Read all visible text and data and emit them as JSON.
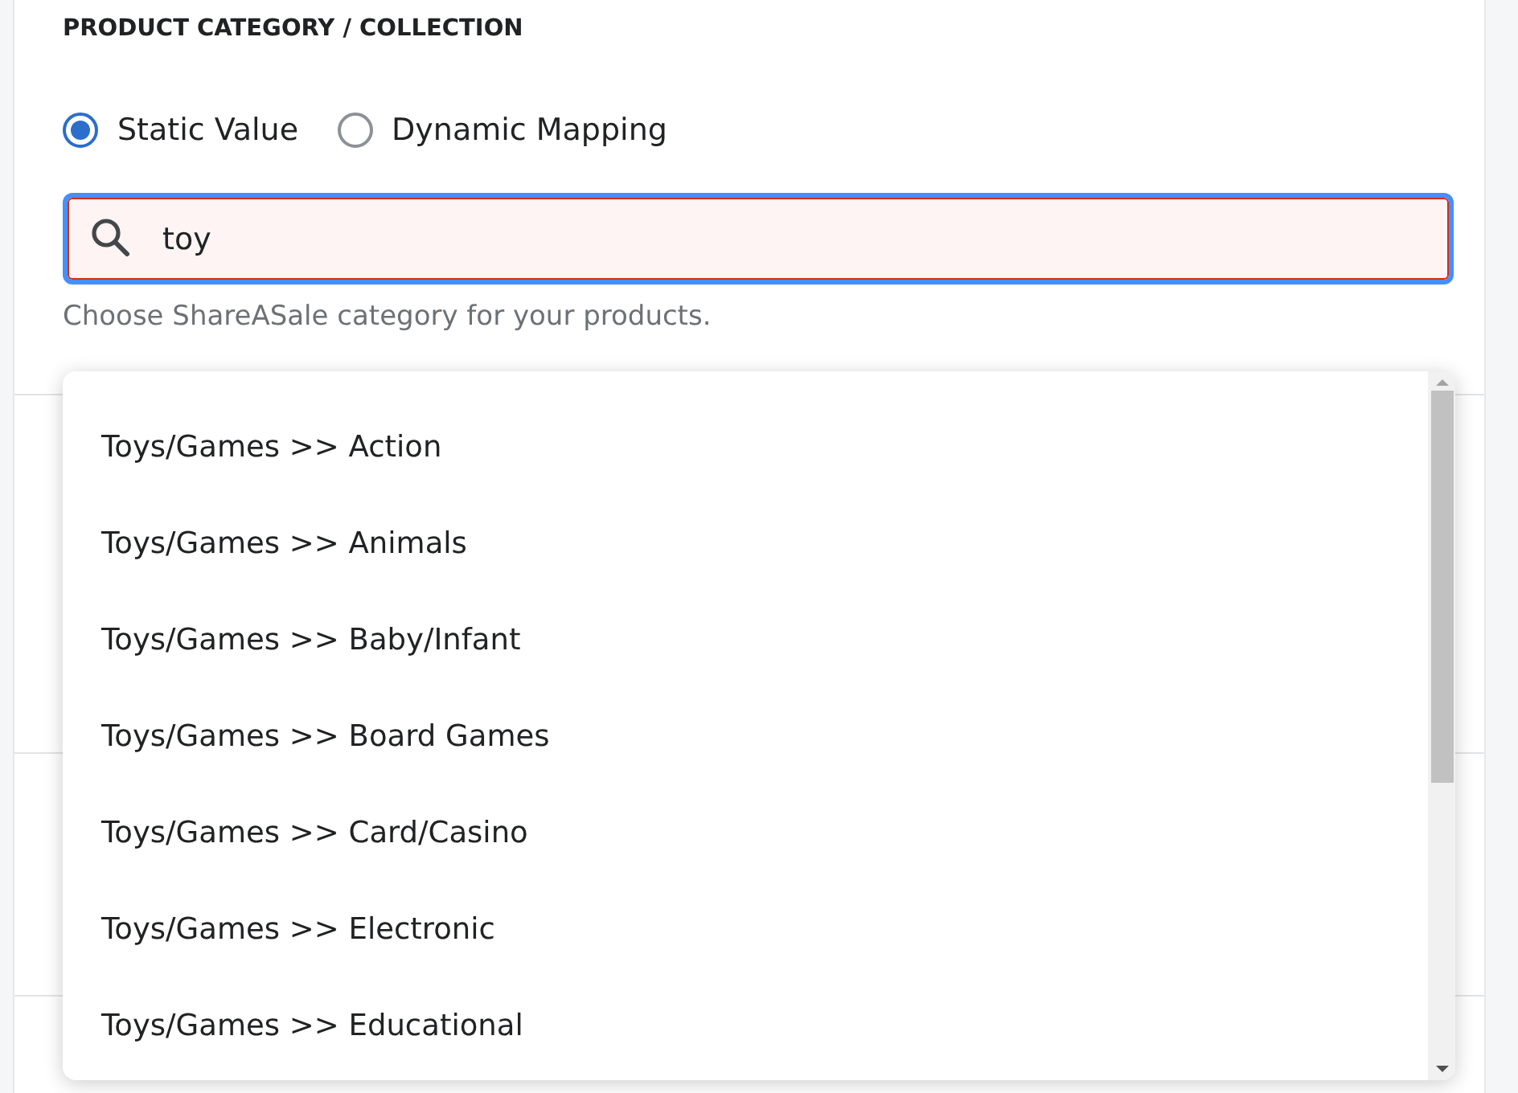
{
  "section": {
    "title": "PRODUCT CATEGORY / COLLECTION"
  },
  "mode_options": [
    {
      "label": "Static Value",
      "selected": true
    },
    {
      "label": "Dynamic Mapping",
      "selected": false
    }
  ],
  "search": {
    "value": "toy",
    "invalid": true
  },
  "help_text": "Choose ShareASale category for your products.",
  "dropdown": {
    "options": [
      "Toys/Games >> Action",
      "Toys/Games >> Animals",
      "Toys/Games >> Baby/Infant",
      "Toys/Games >> Board Games",
      "Toys/Games >> Card/Casino",
      "Toys/Games >> Electronic",
      "Toys/Games >> Educational"
    ]
  }
}
